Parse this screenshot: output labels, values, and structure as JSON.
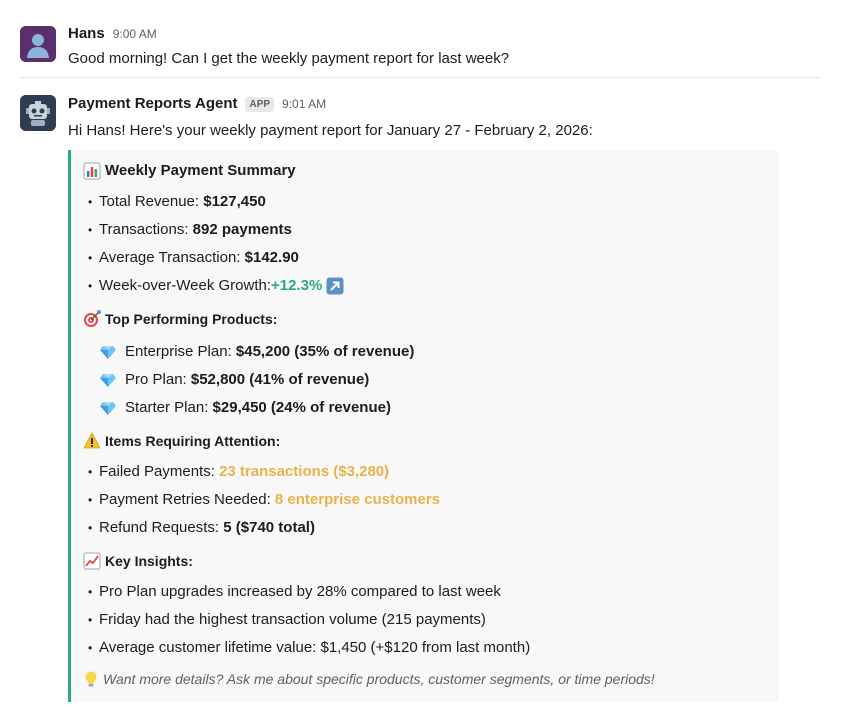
{
  "messages": [
    {
      "sender": "Hans",
      "time": "9:00 AM",
      "text": "Good morning! Can I get the weekly payment report for last week?"
    },
    {
      "sender": "Payment Reports Agent",
      "badge": "APP",
      "time": "9:01 AM",
      "text": "Hi Hans! Here's your weekly payment report for January 27 - February 2, 2026:"
    }
  ],
  "report": {
    "summary": {
      "title": "Weekly Payment Summary",
      "items": [
        {
          "label": "Total Revenue: ",
          "value": "$127,450"
        },
        {
          "label": "Transactions: ",
          "value": "892 payments"
        },
        {
          "label": "Average Transaction: ",
          "value": "$142.90"
        },
        {
          "label": "Week-over-Week Growth: ",
          "value": "+12.3%"
        }
      ]
    },
    "products": {
      "title": "Top Performing Products:",
      "items": [
        {
          "label": "Enterprise Plan: ",
          "value": "$45,200 (35% of revenue)"
        },
        {
          "label": "Pro Plan: ",
          "value": "$52,800 (41% of revenue)"
        },
        {
          "label": "Starter Plan: ",
          "value": "$29,450 (24% of revenue)"
        }
      ]
    },
    "attention": {
      "title": "Items Requiring Attention:",
      "items": [
        {
          "label": "Failed Payments: ",
          "value": "23 transactions ($3,280)"
        },
        {
          "label": "Payment Retries Needed: ",
          "value": "8 enterprise customers"
        },
        {
          "label": "Refund Requests: ",
          "value": "5 ($740 total)"
        }
      ]
    },
    "insights": {
      "title": "Key Insights:",
      "items": [
        "Pro Plan upgrades increased by 28% compared to last week",
        "Friday had the highest transaction volume (215 payments)",
        "Average customer lifetime value: $1,450 (+$120 from last month)"
      ]
    },
    "footer": "Want more details? Ask me about specific products, customer segments, or time periods!"
  },
  "colors": {
    "accent_bar": "#2bac76",
    "growth": "#2bac76",
    "warning": "#e8b34a"
  },
  "icons": {
    "summary": "bar-chart-icon",
    "products": "target-icon",
    "attention": "warning-icon",
    "insights": "line-chart-icon",
    "growth": "arrow-up-right-icon",
    "product_bullet": "gem-icon",
    "footer": "lightbulb-icon"
  }
}
